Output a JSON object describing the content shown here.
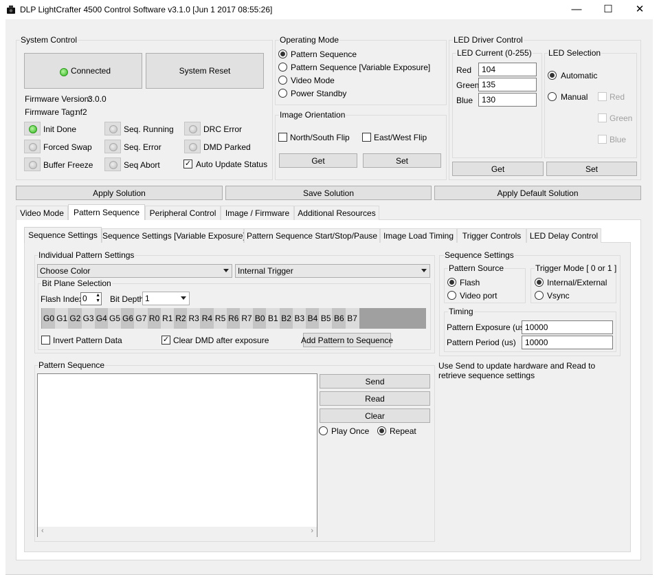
{
  "window": {
    "title": "DLP LightCrafter 4500 Control Software v3.1.0 [Jun  1 2017 08:55:26]",
    "minimize": "—",
    "maximize": "☐",
    "close": "✕"
  },
  "system_control": {
    "title": "System Control",
    "connected_label": "Connected",
    "reset_label": "System Reset",
    "firmware_version_label": "Firmware Version:",
    "firmware_version": "3.0.0",
    "firmware_tag_label": "Firmware Tag:",
    "firmware_tag": "nf2",
    "status": {
      "init_done": "Init Done",
      "forced_swap": "Forced Swap",
      "buffer_freeze": "Buffer Freeze",
      "seq_running": "Seq. Running",
      "seq_error": "Seq. Error",
      "seq_abort": "Seq Abort",
      "drc_error": "DRC Error",
      "dmd_parked": "DMD Parked"
    },
    "auto_update_label": "Auto Update Status"
  },
  "operating_mode": {
    "title": "Operating Mode",
    "options": [
      "Pattern Sequence",
      "Pattern Sequence [Variable Exposure]",
      "Video Mode",
      "Power Standby"
    ],
    "selected": "Pattern Sequence"
  },
  "image_orientation": {
    "title": "Image Orientation",
    "ns_flip": "North/South Flip",
    "ew_flip": "East/West Flip",
    "get": "Get",
    "set": "Set"
  },
  "led_driver": {
    "title": "LED Driver Control",
    "current_title": "LED Current (0-255)",
    "red_label": "Red",
    "red": "104",
    "green_label": "Green",
    "green": "135",
    "blue_label": "Blue",
    "blue": "130",
    "selection_title": "LED Selection",
    "automatic": "Automatic",
    "manual": "Manual",
    "man_red": "Red",
    "man_green": "Green",
    "man_blue": "Blue",
    "get": "Get",
    "set": "Set"
  },
  "solution": {
    "apply": "Apply Solution",
    "save": "Save Solution",
    "apply_default": "Apply Default Solution"
  },
  "main_tabs": [
    "Video Mode",
    "Pattern Sequence",
    "Peripheral Control",
    "Image / Firmware",
    "Additional Resources"
  ],
  "sub_tabs": [
    "Sequence Settings",
    "Sequence Settings [Variable Exposure]",
    "Pattern Sequence Start/Stop/Pause",
    "Image Load Timing",
    "Trigger Controls",
    "LED Delay Control"
  ],
  "individual": {
    "title": "Individual Pattern Settings",
    "color": "Choose Color",
    "trigger": "Internal Trigger",
    "bitplane_title": "Bit Plane Selection",
    "flash_index_label": "Flash Index",
    "flash_index": "0",
    "bit_depth_label": "Bit Depth",
    "bit_depth": "1",
    "bits": [
      "G0",
      "G1",
      "G2",
      "G3",
      "G4",
      "G5",
      "G6",
      "G7",
      "R0",
      "R1",
      "R2",
      "R3",
      "R4",
      "R5",
      "R6",
      "R7",
      "B0",
      "B1",
      "B2",
      "B3",
      "B4",
      "B5",
      "B6",
      "B7"
    ],
    "invert_label": "Invert Pattern Data",
    "clear_dmd_label": "Clear DMD after exposure",
    "add_pattern": "Add Pattern to Sequence"
  },
  "seq_settings": {
    "title": "Sequence Settings",
    "pattern_source_title": "Pattern Source",
    "flash": "Flash",
    "video_port": "Video port",
    "trigger_mode_title": "Trigger Mode [ 0 or 1 ]",
    "internal_external": "Internal/External",
    "vsync": "Vsync",
    "timing_title": "Timing",
    "exposure_label": "Pattern Exposure (us)",
    "exposure": "10000",
    "period_label": "Pattern Period (us)",
    "period": "10000"
  },
  "pattern_sequence": {
    "title": "Pattern Sequence",
    "send": "Send",
    "read": "Read",
    "clear": "Clear",
    "play_once": "Play Once",
    "repeat": "Repeat",
    "hint": "Use Send to update hardware and Read to retrieve sequence settings"
  }
}
